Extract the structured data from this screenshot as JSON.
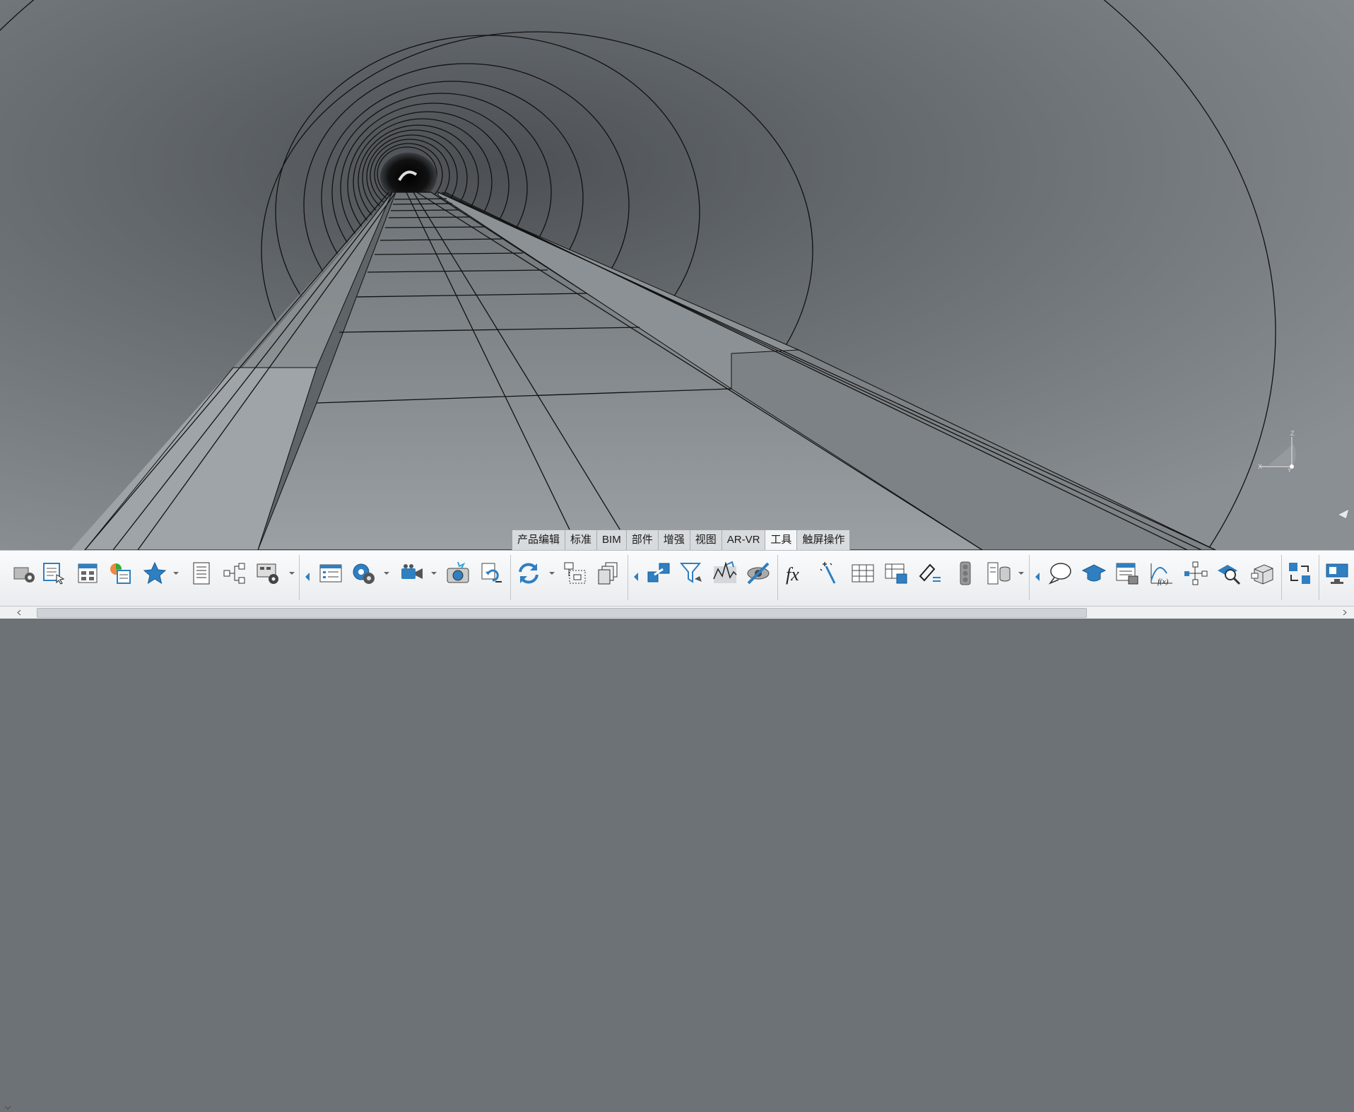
{
  "ribbon": {
    "tabs": [
      {
        "label": "产品编辑"
      },
      {
        "label": "标准"
      },
      {
        "label": "BIM"
      },
      {
        "label": "部件"
      },
      {
        "label": "增强"
      },
      {
        "label": "视图"
      },
      {
        "label": "AR-VR"
      },
      {
        "label": "工具",
        "active": true
      },
      {
        "label": "触屏操作"
      }
    ],
    "active_tab": "工具"
  },
  "toolbar": {
    "icons": [
      "machine-settings-icon",
      "properties-select-icon",
      "table-grid-icon",
      "color-map-icon",
      "star-favorite-icon",
      "list-document-icon",
      "tree-structure-icon",
      "options-panel-icon",
      "properties-list-icon",
      "gear-settings-icon",
      "video-camera-icon",
      "snapshot-camera-icon",
      "undo-steps-icon",
      "refresh-update-icon",
      "select-region-icon",
      "stack-documents-icon",
      "connect-parts-icon",
      "filter-icon",
      "analysis-wave-icon",
      "hide-show-icon",
      "formula-fx-icon",
      "magic-wand-icon",
      "table-icon",
      "table-3d-icon",
      "measure-icon",
      "traffic-light-icon",
      "database-icon",
      "speech-bubble-icon",
      "graduation-cap-icon",
      "report-icon",
      "function-fx-icon",
      "workflow-icon",
      "search-inspect-icon",
      "box-view-icon",
      "swap-views-icon",
      "display-screen-icon"
    ]
  },
  "viewport": {
    "axes_labels": {
      "x": "X",
      "y": "Y",
      "z": "Z"
    }
  },
  "colors": {
    "viewport_bg": "#6d7276",
    "tab_active": "#f4f5f6",
    "toolbar_icon_blue": "#2f7fc1"
  }
}
